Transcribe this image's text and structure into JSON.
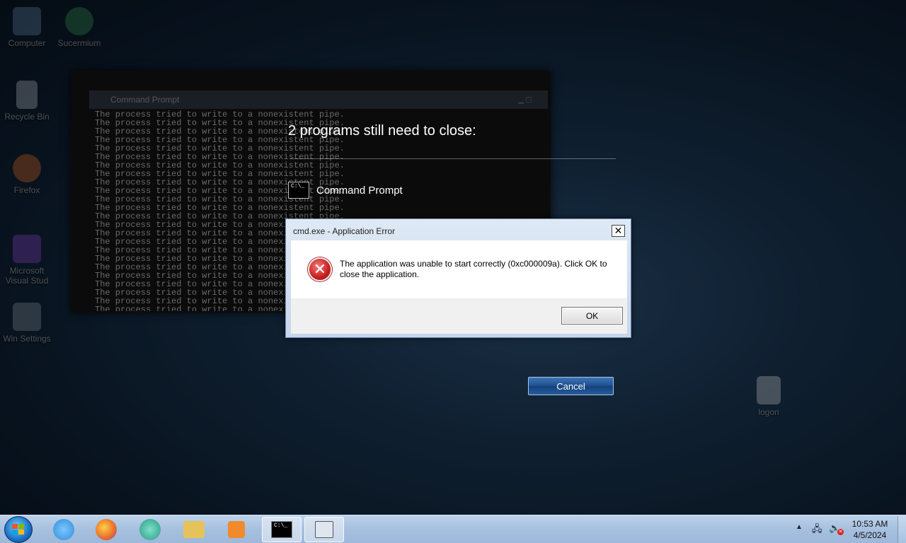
{
  "desktop": {
    "icons": [
      {
        "label": "Computer",
        "icon": "computer-icon",
        "color": "#6b8fb3"
      },
      {
        "label": "Sucermium",
        "icon": "app-icon",
        "color": "#3a9a5a"
      },
      {
        "label": "Recycle Bin",
        "icon": "recycle-bin-icon",
        "color": "#b7c4d1"
      },
      {
        "label": "Firefox",
        "icon": "firefox-icon",
        "color": "#e8742b"
      },
      {
        "label": "Microsoft Visual Stud",
        "icon": "visual-studio-icon",
        "color": "#8f4bd6"
      },
      {
        "label": "Win Settings",
        "icon": "settings-icon",
        "color": "#8a98a8"
      },
      {
        "label": "logon",
        "icon": "file-icon",
        "color": "#d8dde3"
      }
    ]
  },
  "background_window": {
    "title": "Command Prompt",
    "console_line": "The process tried to write to a nonexistent pipe."
  },
  "shutdown": {
    "title": "2 programs still need to close:",
    "programs": [
      {
        "name": "Command Prompt",
        "icon": "command-prompt-icon"
      }
    ],
    "cancel_label": "Cancel"
  },
  "dialog": {
    "title": "cmd.exe - Application Error",
    "message": "The application was unable to start correctly (0xc000009a). Click OK to close the application.",
    "ok_label": "OK",
    "close_glyph": "✕",
    "icon": "error-icon"
  },
  "taskbar": {
    "items": [
      {
        "name": "internet-explorer-icon",
        "color": "#2f8fd8"
      },
      {
        "name": "firefox-icon",
        "color": "#e8742b"
      },
      {
        "name": "app-icon",
        "color": "#2e9a8a"
      },
      {
        "name": "file-explorer-icon",
        "color": "#e6c25a"
      },
      {
        "name": "media-player-icon",
        "color": "#f08a2a"
      },
      {
        "name": "command-prompt-icon",
        "color": "#000000"
      },
      {
        "name": "window-icon",
        "color": "#dfe6ee"
      }
    ],
    "clock": {
      "time": "10:53 AM",
      "date": "4/5/2024"
    }
  }
}
